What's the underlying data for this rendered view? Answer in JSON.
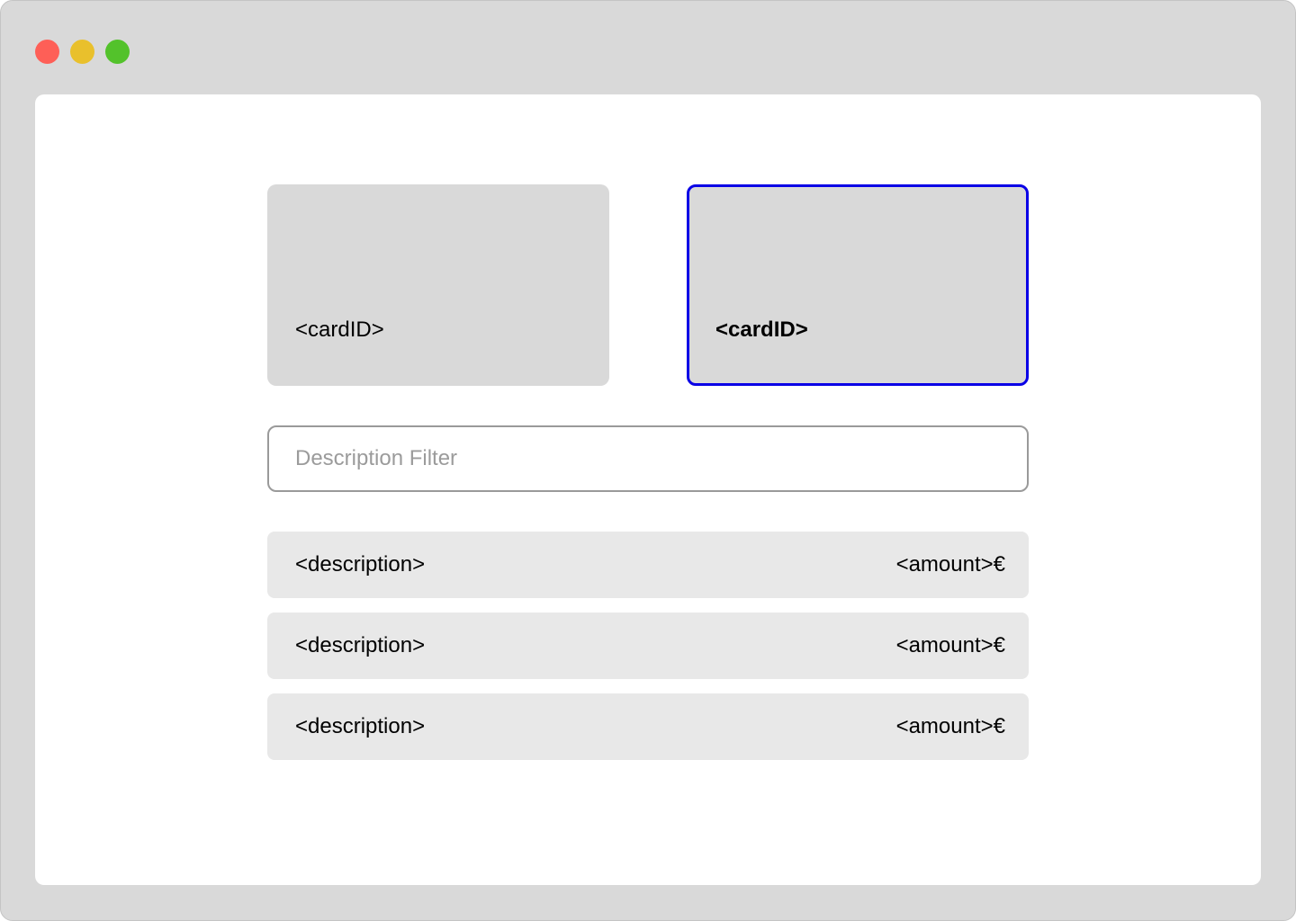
{
  "window": {
    "controls": [
      "close",
      "minimize",
      "maximize"
    ],
    "control_colors": {
      "close": "#fe5f57",
      "minimize": "#e9c02c",
      "maximize": "#53c22b"
    }
  },
  "cards": [
    {
      "label": "<cardID>",
      "selected": false
    },
    {
      "label": "<cardID>",
      "selected": true
    }
  ],
  "selected_color": "#0a00e6",
  "filter": {
    "placeholder": "Description Filter",
    "value": ""
  },
  "transactions": [
    {
      "description": "<description>",
      "amount": "<amount>€"
    },
    {
      "description": "<description>",
      "amount": "<amount>€"
    },
    {
      "description": "<description>",
      "amount": "<amount>€"
    }
  ]
}
